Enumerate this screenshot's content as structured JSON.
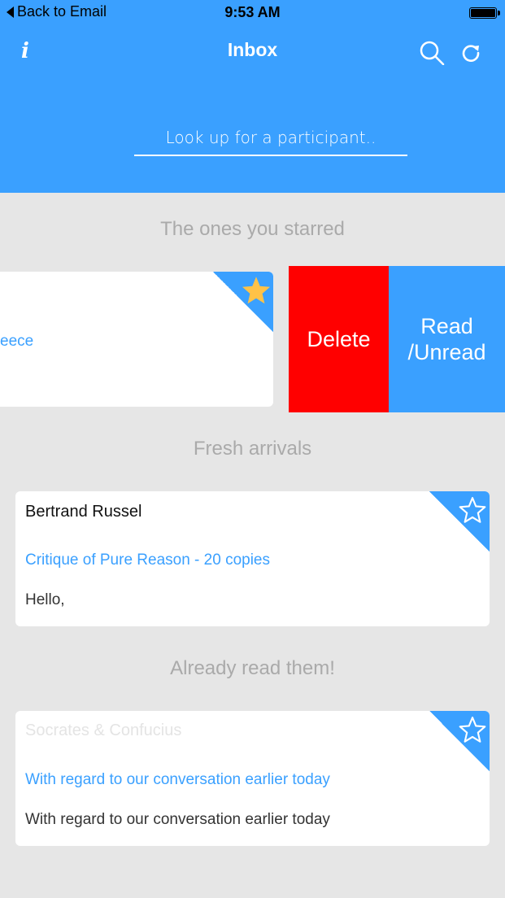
{
  "status_bar": {
    "back_label": "Back to Email",
    "time": "9:53 AM"
  },
  "header": {
    "title": "Inbox"
  },
  "search": {
    "placeholder": "Look up for a participant.."
  },
  "sections": {
    "starred": "The ones you starred",
    "fresh": "Fresh arrivals",
    "read": "Already read them!"
  },
  "starred_card": {
    "subject_fragment": "eece",
    "starred": true
  },
  "swipe_actions": {
    "delete": "Delete",
    "read_unread_line1": "Read",
    "read_unread_line2": "/Unread"
  },
  "fresh_card": {
    "sender": "Bertrand Russel",
    "subject": "Critique of Pure Reason - 20 copies",
    "preview": "Hello,",
    "starred": false
  },
  "read_card": {
    "sender": "Socrates & Confucius",
    "subject": "With regard to our conversation earlier today",
    "preview": "With regard to our conversation earlier today",
    "starred": false
  },
  "colors": {
    "accent": "#3aa0ff",
    "delete": "#ff0000",
    "star_filled": "#ffc247",
    "background": "#e6e6e6"
  }
}
